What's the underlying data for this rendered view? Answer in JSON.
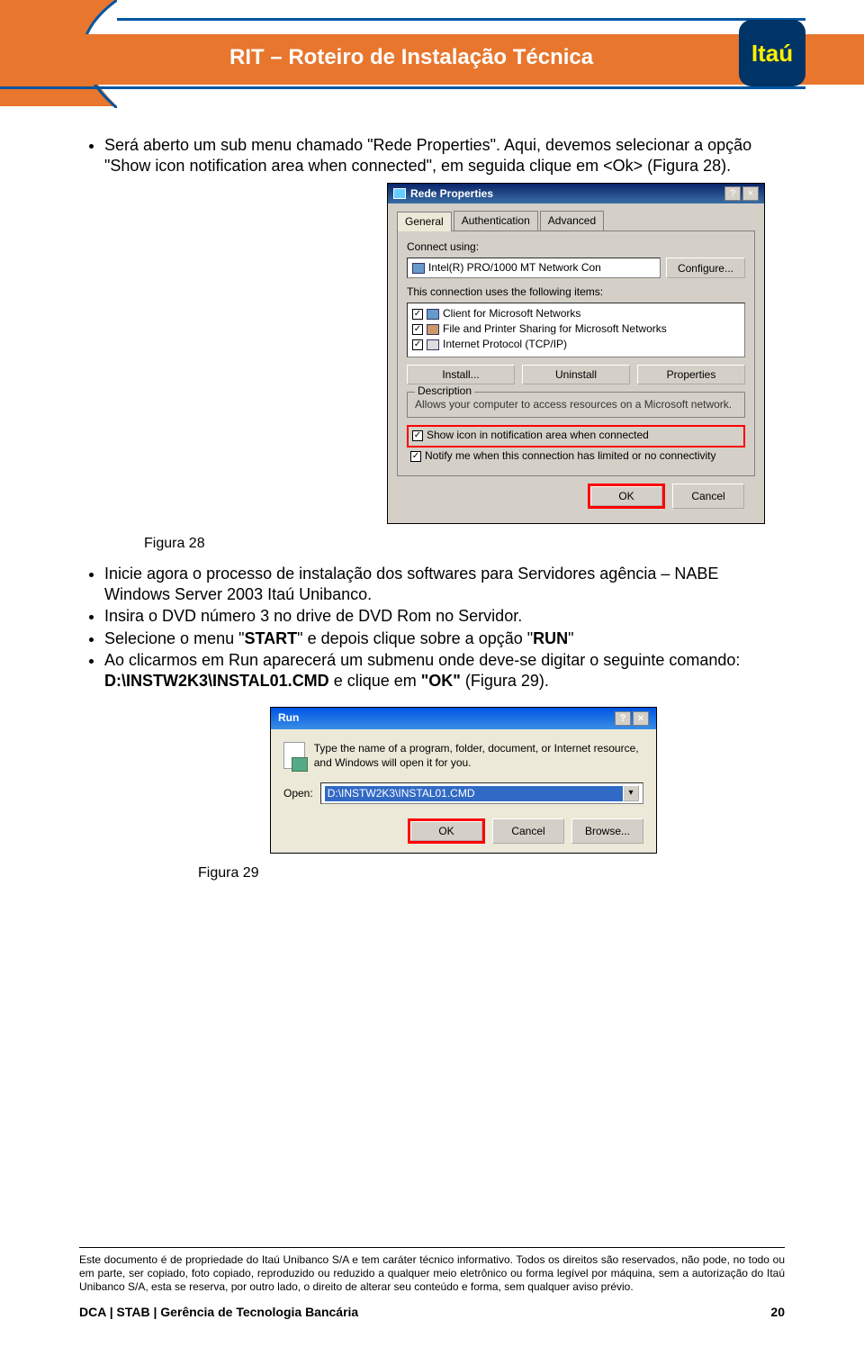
{
  "header": {
    "doc_title": "RIT – Roteiro de Instalação Técnica",
    "logo_text": "Itaú"
  },
  "content": {
    "bullet1": "Será aberto um sub menu chamado \"Rede Properties\". Aqui, devemos selecionar a opção \"Show icon notification area when connected\", em seguida clique em <Ok> (Figura 28)."
  },
  "dlg": {
    "title": "Rede Properties",
    "tabs": {
      "general": "General",
      "auth": "Authentication",
      "advanced": "Advanced"
    },
    "connect_using": "Connect using:",
    "adapter": "Intel(R) PRO/1000 MT Network Con",
    "configure": "Configure...",
    "uses_items": "This connection uses the following items:",
    "items": [
      "Client for Microsoft Networks",
      "File and Printer Sharing for Microsoft Networks",
      "Internet Protocol (TCP/IP)"
    ],
    "install": "Install...",
    "uninstall": "Uninstall",
    "properties": "Properties",
    "desc_label": "Description",
    "desc_text": "Allows your computer to access resources on a Microsoft network.",
    "show_icon": "Show icon in notification area when connected",
    "notify_me": "Notify me when this connection has limited or no connectivity",
    "ok": "OK",
    "cancel": "Cancel"
  },
  "fig28": "Figura 28",
  "bullets2": [
    "Inicie agora o processo de instalação dos softwares para Servidores agência – NABE Windows Server 2003 Itaú Unibanco.",
    "Insira o DVD número 3 no drive de DVD Rom no Servidor."
  ],
  "bullets3": {
    "b3_pre": "Selecione o menu \"",
    "b3_start": "START",
    "b3_mid": "\" e depois clique sobre a opção \"",
    "b3_run": "RUN",
    "b3_end": "\""
  },
  "bullets4": {
    "b4_pre": "Ao clicarmos em Run aparecerá um submenu onde deve-se digitar  o seguinte comando:   ",
    "b4_cmd": "D:\\INSTW2K3\\INSTAL01.CMD",
    "b4_mid": "  e clique em ",
    "b4_ok": "\"OK\"",
    "b4_end": " (Figura 29)."
  },
  "run": {
    "title": "Run",
    "text": "Type the name of a program, folder, document, or Internet resource, and Windows will open it for you.",
    "open_label": "Open:",
    "open_value": "D:\\INSTW2K3\\INSTAL01.CMD",
    "ok": "OK",
    "cancel": "Cancel",
    "browse": "Browse..."
  },
  "fig29": "Figura 29",
  "footer": {
    "disclaimer": "Este documento é de propriedade do Itaú Unibanco S/A e tem caráter técnico informativo. Todos os direitos são reservados, não pode, no todo ou em parte, ser copiado, foto copiado, reproduzido ou reduzido a qualquer meio eletrônico ou forma legível por máquina, sem a autorização do Itaú Unibanco S/A, esta se reserva, por outro lado, o direito de alterar seu conteúdo e forma, sem qualquer aviso prévio.",
    "dept": "DCA | STAB | Gerência de Tecnologia Bancária",
    "page": "20"
  }
}
